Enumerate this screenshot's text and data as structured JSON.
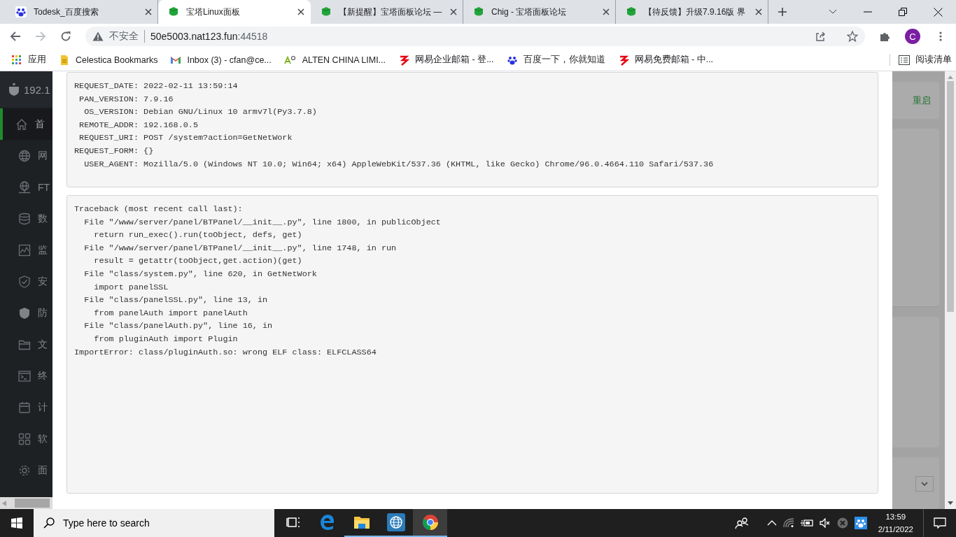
{
  "browser": {
    "tabs": [
      {
        "title": "Todesk_百度搜索",
        "selected": false
      },
      {
        "title": "宝塔Linux面板",
        "selected": true
      },
      {
        "title": "【新提醒】宝塔面板论坛 —",
        "selected": false
      },
      {
        "title": "Chig - 宝塔面板论坛",
        "selected": false
      },
      {
        "title": "【待反馈】升级7.9.16版 界",
        "selected": false
      }
    ],
    "address": {
      "security": "不安全",
      "host": "50e5003.nat123.fun",
      "port": ":44518"
    },
    "profile": "C",
    "bookmarks": [
      "应用",
      "Celestica Bookmarks",
      "Inbox (3) - cfan@ce...",
      "ALTEN CHINA LIMI...",
      "网易企业邮箱 - 登...",
      "百度一下，你就知道",
      "网易免费邮箱 - 中..."
    ],
    "reading_list": "阅读清单"
  },
  "app": {
    "header": "192.1",
    "nav": [
      {
        "label": "首",
        "selected": true
      },
      {
        "label": "网",
        "selected": false
      },
      {
        "label": "FT",
        "selected": false
      },
      {
        "label": "数",
        "selected": false
      },
      {
        "label": "监",
        "selected": false
      },
      {
        "label": "安",
        "selected": false
      },
      {
        "label": "防",
        "selected": false
      },
      {
        "label": "文",
        "selected": false
      },
      {
        "label": "终",
        "selected": false
      },
      {
        "label": "计",
        "selected": false
      },
      {
        "label": "软",
        "selected": false
      },
      {
        "label": "面",
        "selected": false
      }
    ],
    "restart_button": "重启"
  },
  "error_dialog": {
    "request_info": [
      "REQUEST_DATE: 2022-02-11 13:59:14",
      " PAN_VERSION: 7.9.16",
      "  OS_VERSION: Debian GNU/Linux 10 armv7l(Py3.7.8)",
      " REMOTE_ADDR: 192.168.0.5",
      " REQUEST_URI: POST /system?action=GetNetWork",
      "REQUEST_FORM: {}",
      "  USER_AGENT: Mozilla/5.0 (Windows NT 10.0; Win64; x64) AppleWebKit/537.36 (KHTML, like Gecko) Chrome/96.0.4664.110 Safari/537.36"
    ],
    "traceback": [
      "Traceback (most recent call last):",
      "  File \"/www/server/panel/BTPanel/__init__.py\", line 1800, in publicObject",
      "    return run_exec().run(toObject, defs, get)",
      "  File \"/www/server/panel/BTPanel/__init__.py\", line 1748, in run",
      "    result = getattr(toObject,get.action)(get)",
      "  File \"class/system.py\", line 620, in GetNetWork",
      "    import panelSSL",
      "  File \"class/panelSSL.py\", line 13, in",
      "    from panelAuth import panelAuth",
      "  File \"class/panelAuth.py\", line 16, in",
      "    from pluginAuth import Plugin",
      "ImportError: class/pluginAuth.so: wrong ELF class: ELFCLASS64"
    ]
  },
  "taskbar": {
    "search_placeholder": "Type here to search",
    "apps": [
      {
        "kind": "taskview",
        "running": false,
        "selected": false
      },
      {
        "kind": "edge",
        "running": false,
        "selected": false
      },
      {
        "kind": "explorer",
        "running": true,
        "selected": false
      },
      {
        "kind": "network",
        "running": true,
        "selected": false
      },
      {
        "kind": "chrome",
        "running": true,
        "selected": true
      }
    ],
    "time": "13:59",
    "date": "2/11/2022"
  }
}
